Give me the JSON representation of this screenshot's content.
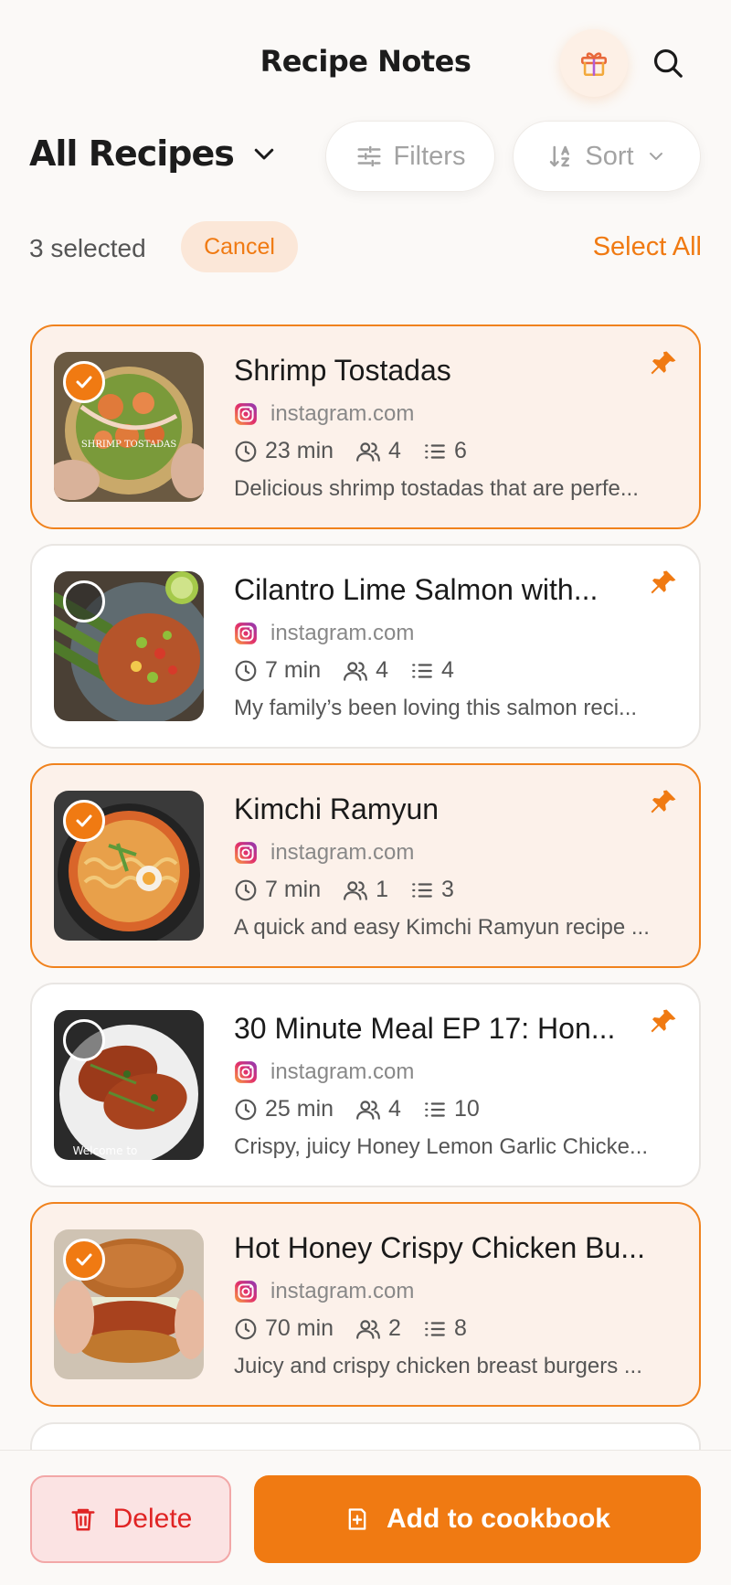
{
  "app": {
    "title": "Recipe Notes"
  },
  "icons": {
    "gift": "gift-icon",
    "search": "search-icon",
    "filters": "sliders-icon",
    "sort": "sort-az-icon",
    "chevron": "chevron-down-icon",
    "pin": "pin-icon",
    "instagram": "instagram-icon",
    "clock": "clock-icon",
    "servings": "people-icon",
    "steps": "list-icon",
    "trash": "trash-icon",
    "add": "add-to-book-icon"
  },
  "collection": {
    "title": "All Recipes"
  },
  "toolbar": {
    "filters_label": "Filters",
    "sort_label": "Sort"
  },
  "selection": {
    "count_text": "3 selected",
    "cancel_label": "Cancel",
    "select_all_label": "Select All"
  },
  "colors": {
    "accent": "#f07a12",
    "selected_bg": "#fcf1ea",
    "delete": "#e02424"
  },
  "recipes": [
    {
      "title": "Shrimp Tostadas",
      "source": "instagram.com",
      "time": "23 min",
      "servings": "4",
      "steps": "6",
      "description": "Delicious shrimp tostadas that are perfe...",
      "selected": true,
      "pinned": true,
      "thumb_text": "SHRIMP TOSTADAS"
    },
    {
      "title": "Cilantro Lime Salmon with...",
      "source": "instagram.com",
      "time": "7 min",
      "servings": "4",
      "steps": "4",
      "description": "My family’s been loving this salmon reci...",
      "selected": false,
      "pinned": true,
      "thumb_text": ""
    },
    {
      "title": "Kimchi Ramyun",
      "source": "instagram.com",
      "time": "7 min",
      "servings": "1",
      "steps": "3",
      "description": "A quick and easy Kimchi Ramyun recipe ...",
      "selected": true,
      "pinned": true,
      "thumb_text": ""
    },
    {
      "title": "30 Minute Meal EP 17: Hon...",
      "source": "instagram.com",
      "time": "25 min",
      "servings": "4",
      "steps": "10",
      "description": "Crispy, juicy Honey Lemon Garlic Chicke...",
      "selected": false,
      "pinned": true,
      "thumb_text": "Welcome to"
    },
    {
      "title": "Hot Honey Crispy Chicken Bu...",
      "source": "instagram.com",
      "time": "70 min",
      "servings": "2",
      "steps": "8",
      "description": "Juicy and crispy chicken breast burgers ...",
      "selected": true,
      "pinned": false,
      "thumb_text": ""
    }
  ],
  "actions": {
    "delete_label": "Delete",
    "cookbook_label": "Add to cookbook"
  }
}
